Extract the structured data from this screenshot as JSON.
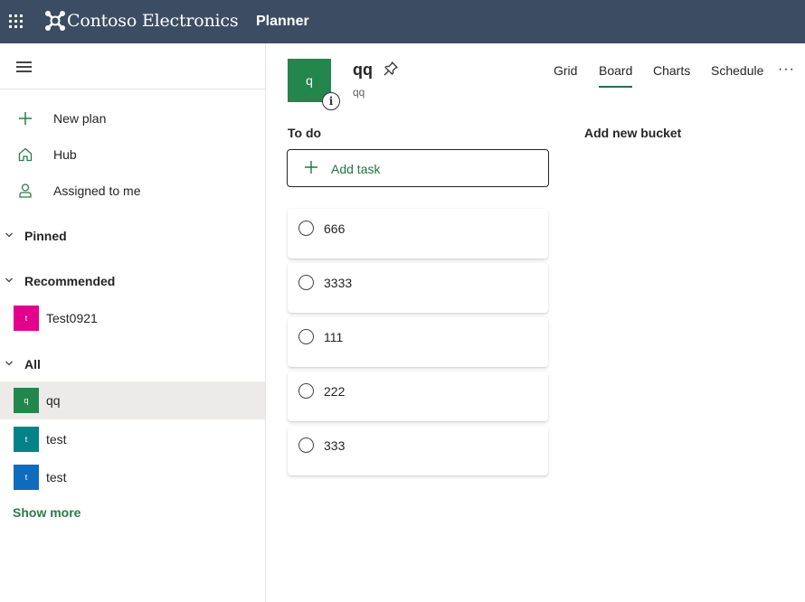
{
  "topbar": {
    "brand": "Contoso Electronics",
    "app_name": "Planner"
  },
  "sidebar": {
    "nav": [
      {
        "label": "New plan",
        "icon": "plus-icon"
      },
      {
        "label": "Hub",
        "icon": "home-icon"
      },
      {
        "label": "Assigned to me",
        "icon": "person-icon"
      }
    ],
    "sections": {
      "pinned": "Pinned",
      "recommended": "Recommended",
      "all": "All"
    },
    "recommended_plans": [
      {
        "label": "Test0921",
        "initial": "t",
        "color": "#e3008c"
      }
    ],
    "all_plans": [
      {
        "label": "qq",
        "initial": "q",
        "color": "#23864c",
        "selected": true
      },
      {
        "label": "test",
        "initial": "t",
        "color": "#038387"
      },
      {
        "label": "test",
        "initial": "t",
        "color": "#0f6cbd"
      }
    ],
    "show_more": "Show more"
  },
  "plan": {
    "initial": "q",
    "title": "qq",
    "subtitle": "qq",
    "avatar_color": "#23864c"
  },
  "tabs": [
    {
      "label": "Grid",
      "active": false
    },
    {
      "label": "Board",
      "active": true
    },
    {
      "label": "Charts",
      "active": false
    },
    {
      "label": "Schedule",
      "active": false
    }
  ],
  "board": {
    "bucket_title": "To do",
    "add_task": "Add task",
    "add_bucket": "Add new bucket",
    "tasks": [
      "666",
      "3333",
      "111",
      "222",
      "333"
    ]
  },
  "colors": {
    "topbar": "#3c4d63",
    "accent": "#217346"
  }
}
